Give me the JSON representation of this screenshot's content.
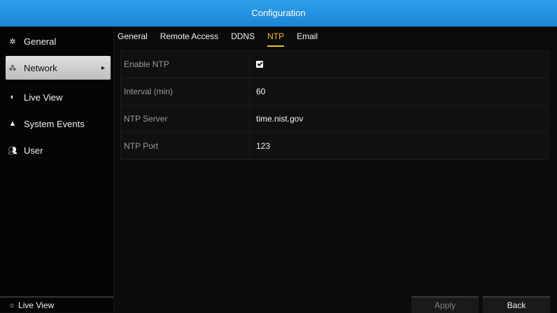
{
  "window": {
    "title": "Configuration"
  },
  "sidebar": {
    "items": [
      {
        "label": "General",
        "icon": "gear-icon",
        "active": false
      },
      {
        "label": "Network",
        "icon": "network-icon",
        "active": true
      },
      {
        "label": "Live View",
        "icon": "camera-icon",
        "active": false
      },
      {
        "label": "System Events",
        "icon": "warning-icon",
        "active": false
      },
      {
        "label": "User",
        "icon": "users-icon",
        "active": false
      }
    ],
    "bottom": {
      "label": "Live View",
      "icon": "home-icon"
    }
  },
  "tabs": [
    {
      "label": "General",
      "active": false
    },
    {
      "label": "Remote Access",
      "active": false
    },
    {
      "label": "DDNS",
      "active": false
    },
    {
      "label": "NTP",
      "active": true
    },
    {
      "label": "Email",
      "active": false
    }
  ],
  "form": {
    "rows": [
      {
        "label": "Enable NTP",
        "value": "",
        "checked": true
      },
      {
        "label": "Interval (min)",
        "value": "60"
      },
      {
        "label": "NTP Server",
        "value": "time.nist.gov"
      },
      {
        "label": "NTP Port",
        "value": "123"
      }
    ]
  },
  "footer": {
    "apply_label": "Apply",
    "back_label": "Back"
  },
  "colors": {
    "accent": "#1e8ee0",
    "active_tab": "#f3c51a"
  }
}
